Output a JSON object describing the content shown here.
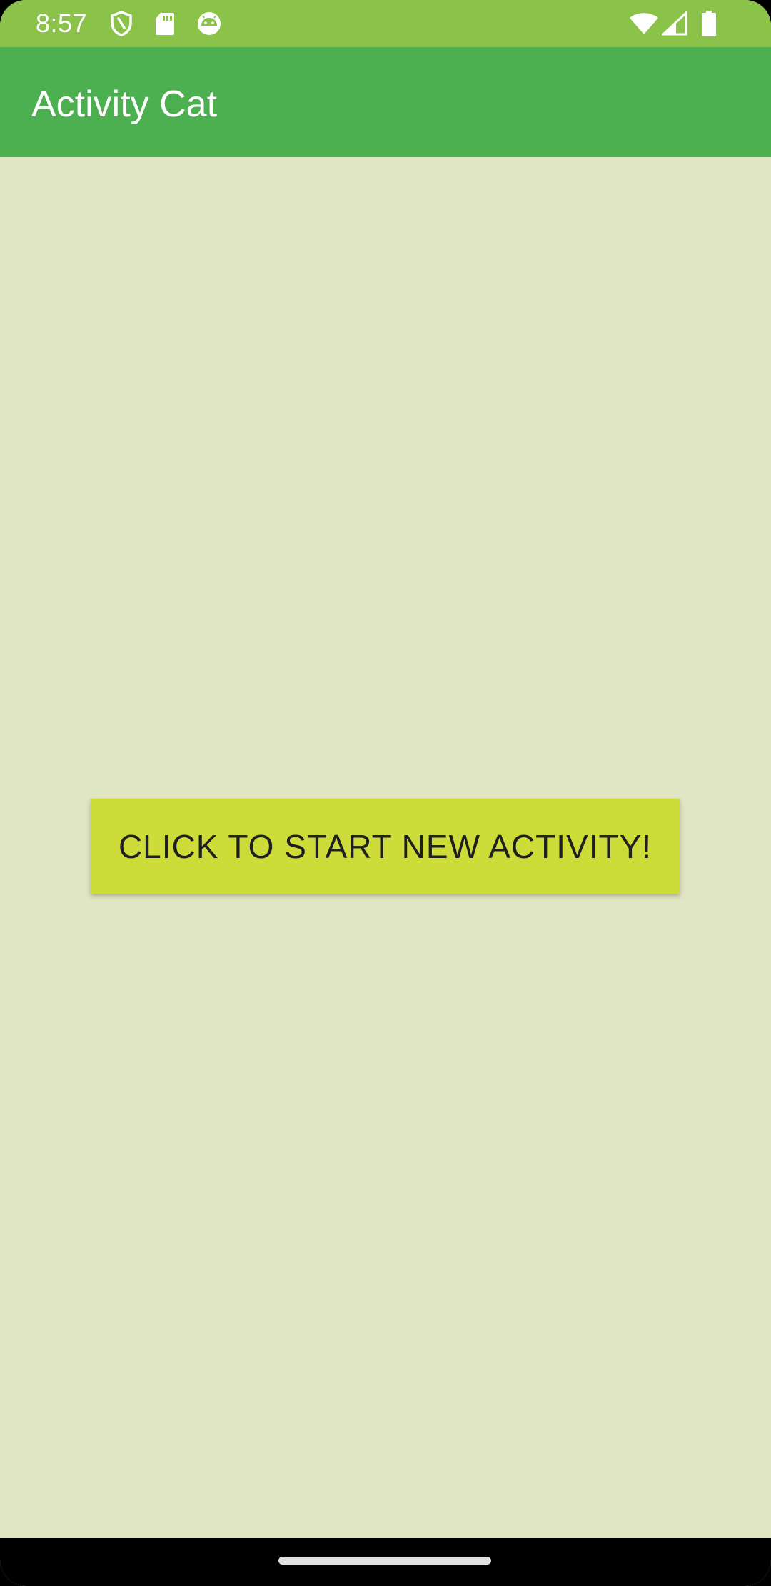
{
  "status_bar": {
    "time": "8:57",
    "icons_left": [
      "shield-icon",
      "sd-card-icon",
      "android-head-icon"
    ],
    "icons_right": [
      "wifi-icon",
      "cell-signal-icon",
      "battery-icon"
    ]
  },
  "app_bar": {
    "title": "Activity Cat"
  },
  "main": {
    "start_button_label": "CLICK TO START NEW ACTIVITY!"
  },
  "colors": {
    "status_bar": "#8bc34a",
    "app_bar": "#4caf50",
    "background": "#e0e5c3",
    "button": "#cddc39",
    "button_text": "#1f1f1f"
  }
}
